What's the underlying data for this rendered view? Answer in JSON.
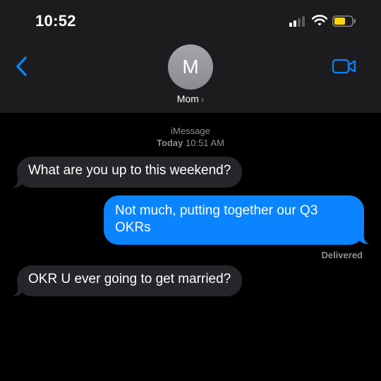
{
  "status_bar": {
    "time": "10:52",
    "battery_color": "#ffd60a"
  },
  "nav": {
    "back_icon": "chevron-left-icon",
    "avatar_initial": "M",
    "contact_name": "Mom",
    "contact_chevron": "›",
    "video_icon": "video-camera-icon",
    "accent_color": "#0a84ff"
  },
  "thread": {
    "service": "iMessage",
    "day": "Today",
    "time": "10:51 AM",
    "messages": [
      {
        "direction": "incoming",
        "text": "What are you up to this weekend?"
      },
      {
        "direction": "outgoing",
        "text": "Not much, putting together our Q3 OKRs"
      },
      {
        "direction": "incoming",
        "text": "OKR U ever going to get married?"
      }
    ],
    "delivery_status": "Delivered",
    "incoming_bubble_color": "#26252a",
    "outgoing_bubble_color": "#0a84ff"
  }
}
